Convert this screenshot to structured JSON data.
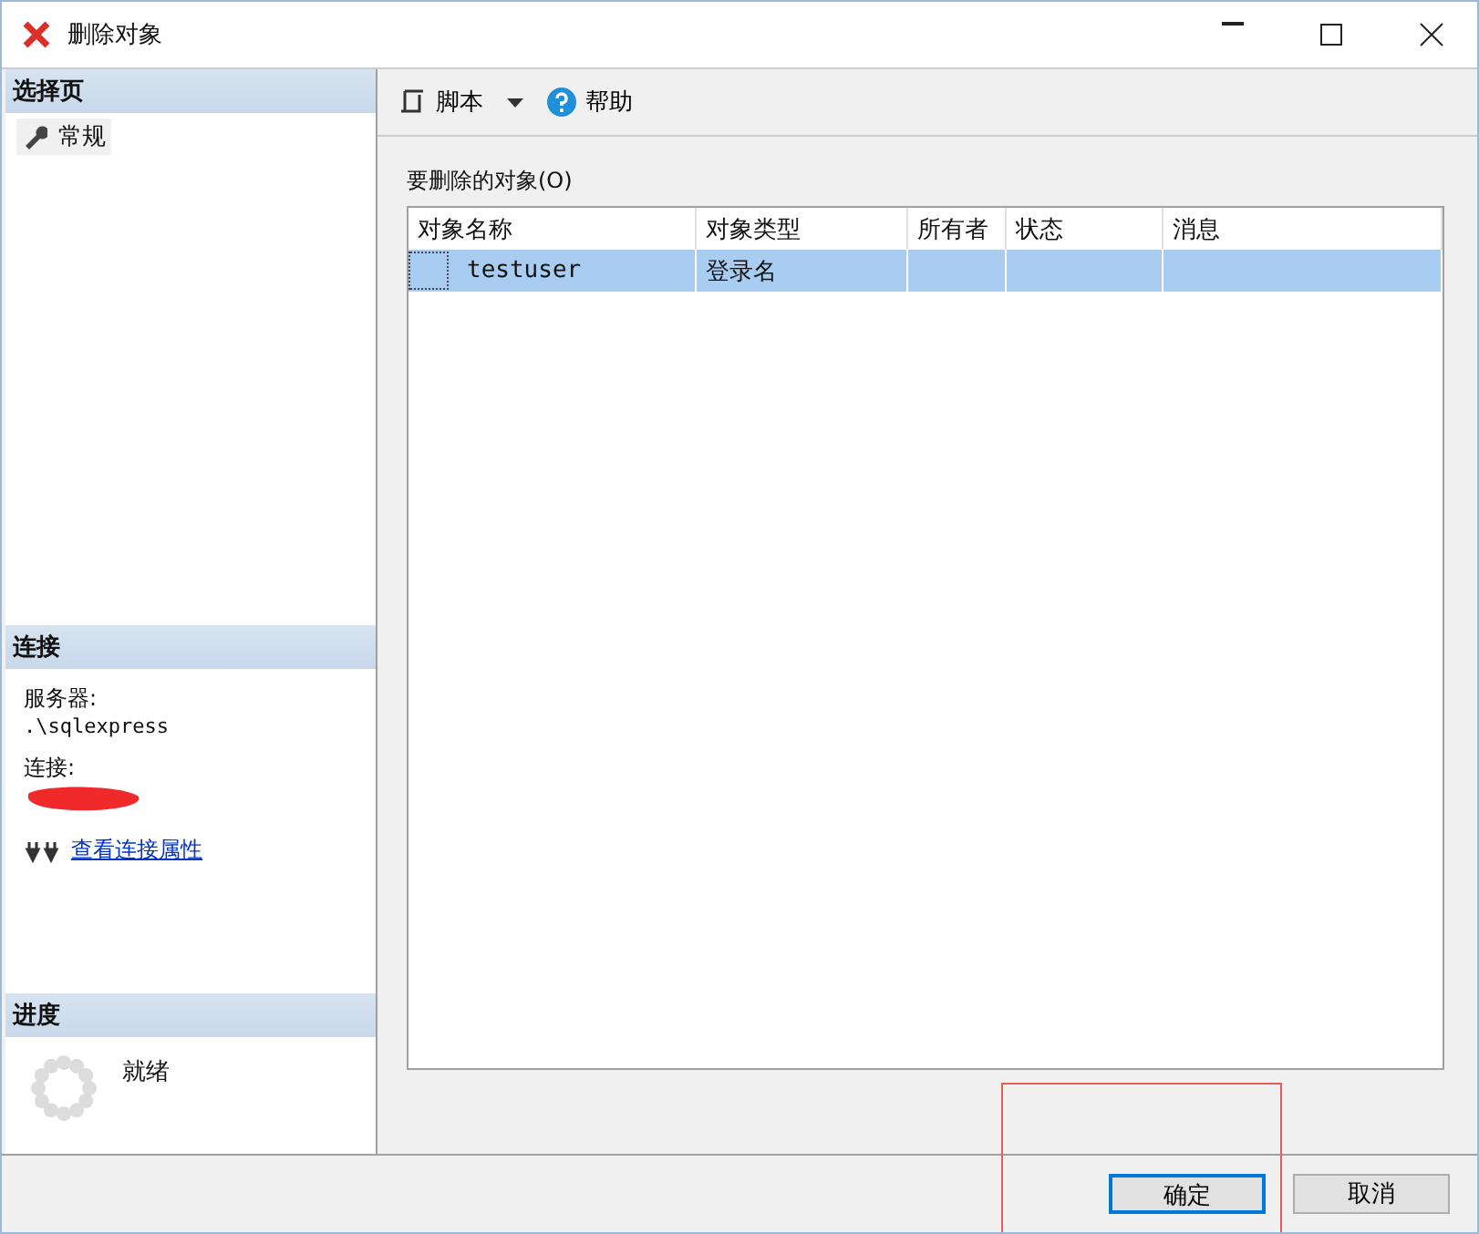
{
  "window": {
    "title": "删除对象"
  },
  "sidebar": {
    "select_header": "选择页",
    "pages": [
      {
        "label": "常规",
        "selected": true
      }
    ],
    "connection_header": "连接",
    "server_label": "服务器:",
    "server": ".\\sqlexpress",
    "connection_label": "连接:",
    "connection_redacted": true,
    "link": "查看连接属性",
    "progress_header": "进度",
    "progress_status": "就绪"
  },
  "toolbar": {
    "script": "脚本",
    "help": "帮助"
  },
  "objects": {
    "label": "要删除的对象(O)",
    "columns": [
      "对象名称",
      "对象类型",
      "所有者",
      "状态",
      "消息"
    ],
    "rows": [
      {
        "cells": [
          "testuser",
          "登录名",
          "",
          "",
          ""
        ],
        "selected": true
      }
    ]
  },
  "buttons": [
    {
      "label": "确定",
      "default": true
    },
    {
      "label": "取消",
      "default": false
    }
  ],
  "annotation": {
    "highlight_ok": true
  }
}
